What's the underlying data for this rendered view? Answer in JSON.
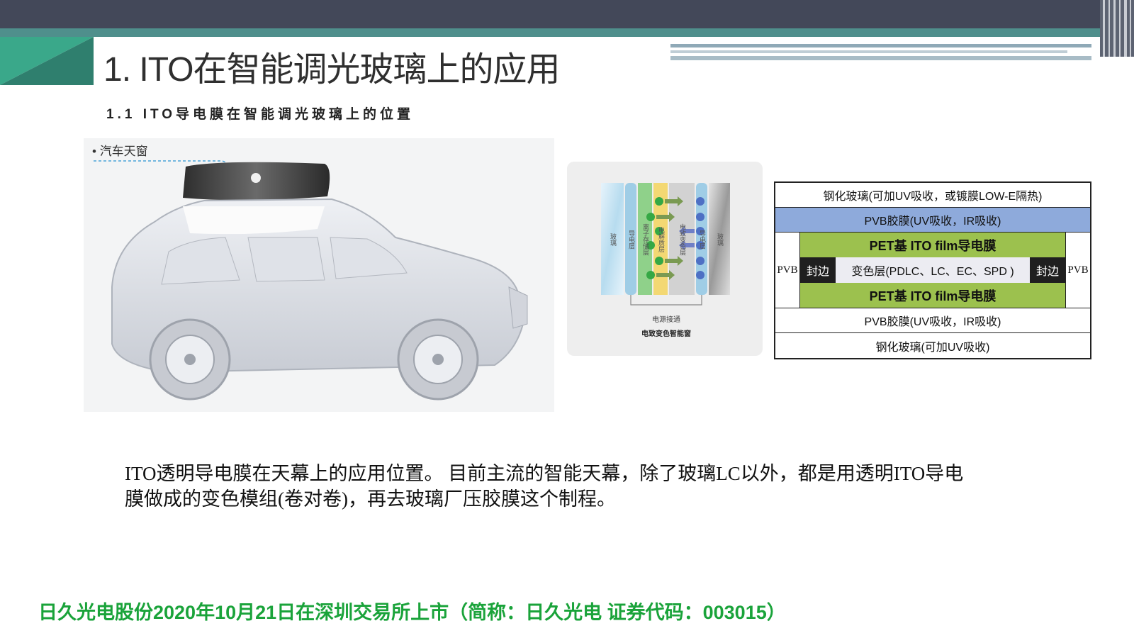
{
  "slide": {
    "title": "1. ITO在智能调光玻璃上的应用",
    "subtitle": "1.1 ITO导电膜在智能调光玻璃上的位置"
  },
  "car_image": {
    "label": "汽车天窗"
  },
  "ec_diagram": {
    "layer_labels": [
      "玻璃",
      "导电层",
      "离子存储层",
      "电解质层",
      "电致变色层",
      "导电层",
      "玻璃"
    ],
    "power_label": "电源接通",
    "caption": "电致变色智能窗"
  },
  "layer_stack": {
    "top_glass": "钢化玻璃(可加UV吸收，或镀膜LOW-E隔热)",
    "top_pvb": "PVB胶膜(UV吸收，IR吸收)",
    "pet_top": "PET基 ITO film导电膜",
    "side_pvb_left": "PVB",
    "seal_left": "封边",
    "change_layer": "变色层(PDLC、LC、EC、SPD )",
    "seal_right": "封边",
    "side_pvb_right": "PVB",
    "pet_bottom": "PET基 ITO film导电膜",
    "bottom_pvb": "PVB胶膜(UV吸收，IR吸收)",
    "bottom_glass": "钢化玻璃(可加UV吸收)"
  },
  "body_text": "ITO透明导电膜在天幕上的应用位置。 目前主流的智能天幕，除了玻璃LC以外，都是用透明ITO导电膜做成的变色模组(卷对卷)，再去玻璃厂压胶膜这个制程。",
  "footer": "日久光电股份2020年10月21日在深圳交易所上市（简称：日久光电 证券代码：003015）",
  "colors": {
    "header_dark": "#434859",
    "header_teal": "#4f8f8c",
    "corner_green": "#3aa88a",
    "pvb_blue": "#8eaadb",
    "pet_green": "#9cc14e",
    "footer_green": "#1aa33a"
  }
}
